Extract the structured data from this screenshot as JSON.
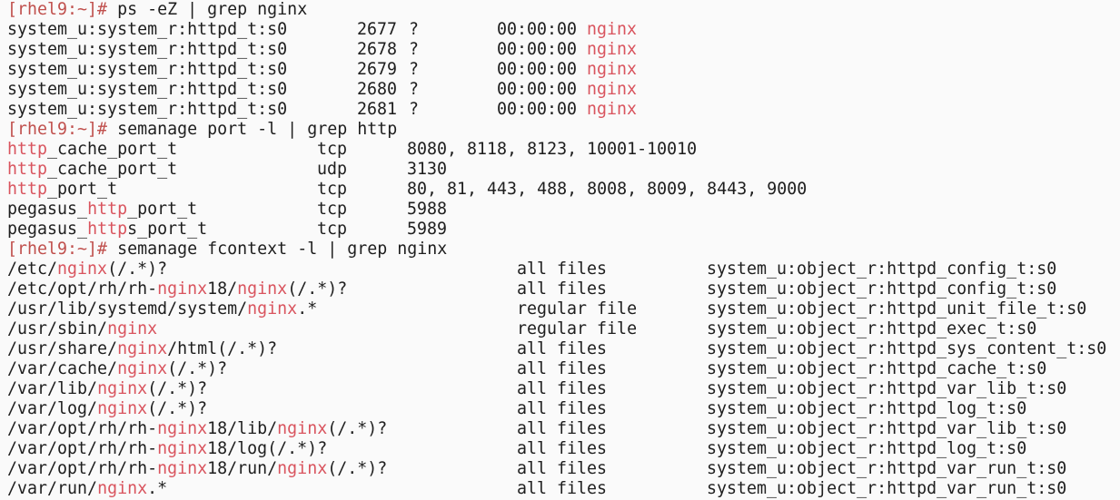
{
  "terminal": {
    "prompt": "[rhel9:~]#",
    "commands": [
      "ps -eZ | grep nginx",
      "semanage port -l | grep http",
      "semanage fcontext -l | grep nginx"
    ],
    "ps_rows": [
      {
        "context": "system_u:system_r:httpd_t:s0",
        "pid": "2677",
        "tty": "?",
        "time": "00:00:00",
        "cmd": "nginx"
      },
      {
        "context": "system_u:system_r:httpd_t:s0",
        "pid": "2678",
        "tty": "?",
        "time": "00:00:00",
        "cmd": "nginx"
      },
      {
        "context": "system_u:system_r:httpd_t:s0",
        "pid": "2679",
        "tty": "?",
        "time": "00:00:00",
        "cmd": "nginx"
      },
      {
        "context": "system_u:system_r:httpd_t:s0",
        "pid": "2680",
        "tty": "?",
        "time": "00:00:00",
        "cmd": "nginx"
      },
      {
        "context": "system_u:system_r:httpd_t:s0",
        "pid": "2681",
        "tty": "?",
        "time": "00:00:00",
        "cmd": "nginx"
      }
    ],
    "port_rows": [
      {
        "type": "http_cache_port_t",
        "proto": "tcp",
        "ports": "8080, 8118, 8123, 10001-10010"
      },
      {
        "type": "http_cache_port_t",
        "proto": "udp",
        "ports": "3130"
      },
      {
        "type": "http_port_t",
        "proto": "tcp",
        "ports": "80, 81, 443, 488, 8008, 8009, 8443, 9000"
      },
      {
        "type": "pegasus_http_port_t",
        "proto": "tcp",
        "ports": "5988"
      },
      {
        "type": "pegasus_https_port_t",
        "proto": "tcp",
        "ports": "5989"
      }
    ],
    "fcontext_rows": [
      {
        "path": "/etc/nginx(/.*)?",
        "ftype": "all files",
        "context": "system_u:object_r:httpd_config_t:s0"
      },
      {
        "path": "/etc/opt/rh/rh-nginx18/nginx(/.*)?",
        "ftype": "all files",
        "context": "system_u:object_r:httpd_config_t:s0"
      },
      {
        "path": "/usr/lib/systemd/system/nginx.*",
        "ftype": "regular file",
        "context": "system_u:object_r:httpd_unit_file_t:s0"
      },
      {
        "path": "/usr/sbin/nginx",
        "ftype": "regular file",
        "context": "system_u:object_r:httpd_exec_t:s0"
      },
      {
        "path": "/usr/share/nginx/html(/.*)?",
        "ftype": "all files",
        "context": "system_u:object_r:httpd_sys_content_t:s0"
      },
      {
        "path": "/var/cache/nginx(/.*)?",
        "ftype": "all files",
        "context": "system_u:object_r:httpd_cache_t:s0"
      },
      {
        "path": "/var/lib/nginx(/.*)?",
        "ftype": "all files",
        "context": "system_u:object_r:httpd_var_lib_t:s0"
      },
      {
        "path": "/var/log/nginx(/.*)?",
        "ftype": "all files",
        "context": "system_u:object_r:httpd_log_t:s0"
      },
      {
        "path": "/var/opt/rh/rh-nginx18/lib/nginx(/.*)?",
        "ftype": "all files",
        "context": "system_u:object_r:httpd_var_lib_t:s0"
      },
      {
        "path": "/var/opt/rh/rh-nginx18/log(/.*)?",
        "ftype": "all files",
        "context": "system_u:object_r:httpd_log_t:s0"
      },
      {
        "path": "/var/opt/rh/rh-nginx18/run/nginx(/.*)?",
        "ftype": "all files",
        "context": "system_u:object_r:httpd_var_run_t:s0"
      },
      {
        "path": "/var/run/nginx.*",
        "ftype": "all files",
        "context": "system_u:object_r:httpd_var_run_t:s0"
      }
    ],
    "colors": {
      "background": "#fafafa",
      "text": "#1e1e1e",
      "prompt": "#c0504d",
      "match_highlight": "#d9545e"
    }
  }
}
